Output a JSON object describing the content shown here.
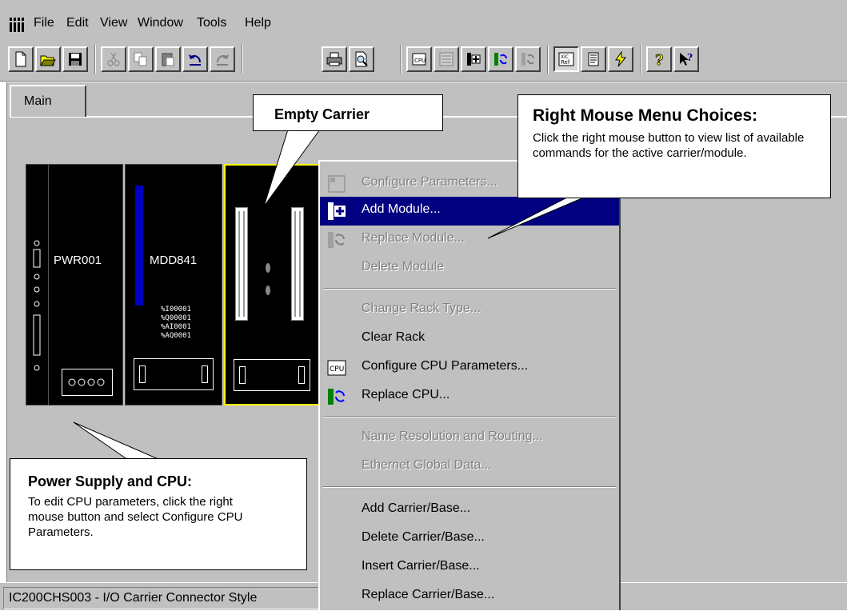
{
  "menu": {
    "items": [
      {
        "label": "File"
      },
      {
        "label": "Edit"
      },
      {
        "label": "View"
      },
      {
        "label": "Window"
      },
      {
        "label": "Tools"
      },
      {
        "label": "Help"
      }
    ]
  },
  "toolbar": {
    "buttons": [
      "new-icon",
      "open-icon",
      "save-icon",
      "cut-icon",
      "copy-icon",
      "paste-icon",
      "undo-icon",
      "redo-icon",
      "print-icon",
      "print-preview-icon",
      "cpu-icon",
      "io-icon",
      "add-module-icon",
      "replace-module-icon",
      "replace-disabled-icon",
      "reference-icon",
      "report-icon",
      "wizard-icon",
      "help-icon",
      "context-help-icon"
    ],
    "pressed": "reference-icon"
  },
  "workspace": {
    "tab_label": "Main"
  },
  "rack": {
    "power_supply_label": "PWR001",
    "cpu_label": "MDD841",
    "cpu_references": [
      "%I00001",
      "%Q00001",
      "%AI0001",
      "%AQ0001"
    ],
    "selection_color": "#ffff00"
  },
  "context_menu": {
    "items": [
      {
        "label": "Configure Parameters...",
        "enabled": false
      },
      {
        "label": "Add Module...",
        "enabled": true,
        "selected": true
      },
      {
        "label": "Replace Module...",
        "enabled": false
      },
      {
        "label": "Delete Module",
        "enabled": false
      },
      {
        "label": "Change Rack Type...",
        "enabled": false
      },
      {
        "label": "Clear Rack",
        "enabled": true
      },
      {
        "label": "Configure CPU Parameters...",
        "enabled": true
      },
      {
        "label": "Replace CPU...",
        "enabled": true
      },
      {
        "label": "Name Resolution and Routing...",
        "enabled": false
      },
      {
        "label": "Ethernet Global Data...",
        "enabled": false
      },
      {
        "label": "Add Carrier/Base...",
        "enabled": true
      },
      {
        "label": "Delete Carrier/Base...",
        "enabled": true
      },
      {
        "label": "Insert Carrier/Base...",
        "enabled": true
      },
      {
        "label": "Replace Carrier/Base...",
        "enabled": true
      }
    ],
    "selection_color": "#000080"
  },
  "callouts": {
    "empty_carrier": {
      "title": "Empty Carrier"
    },
    "right_mouse": {
      "title": "Right Mouse Menu Choices:",
      "body": "Click the right mouse button to view list of available commands for the active carrier/module."
    },
    "power_cpu": {
      "title": "Power Supply and CPU:",
      "body": "To edit CPU parameters, click the right mouse button and select Configure CPU Parameters."
    }
  },
  "status": {
    "text": "IC200CHS003 - I/O Carrier Connector Style"
  }
}
